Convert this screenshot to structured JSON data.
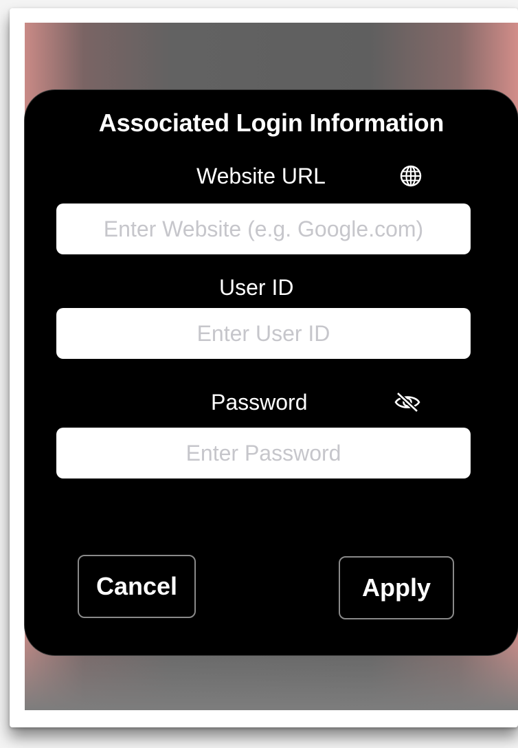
{
  "dialog": {
    "title": "Associated Login Information",
    "fields": {
      "website": {
        "label": "Website URL",
        "placeholder": "Enter Website (e.g. Google.com)",
        "value": "",
        "icon": "globe-icon"
      },
      "user_id": {
        "label": "User ID",
        "placeholder": "Enter User ID",
        "value": ""
      },
      "password": {
        "label": "Password",
        "placeholder": "Enter Password",
        "value": "",
        "icon": "eye-slash-icon"
      }
    },
    "buttons": {
      "cancel": "Cancel",
      "apply": "Apply"
    }
  },
  "colors": {
    "dialog_background": "#000000",
    "input_background": "#ffffff",
    "placeholder_text": "#c6c6cb",
    "text": "#ffffff",
    "button_border": "#8a8a8a"
  }
}
